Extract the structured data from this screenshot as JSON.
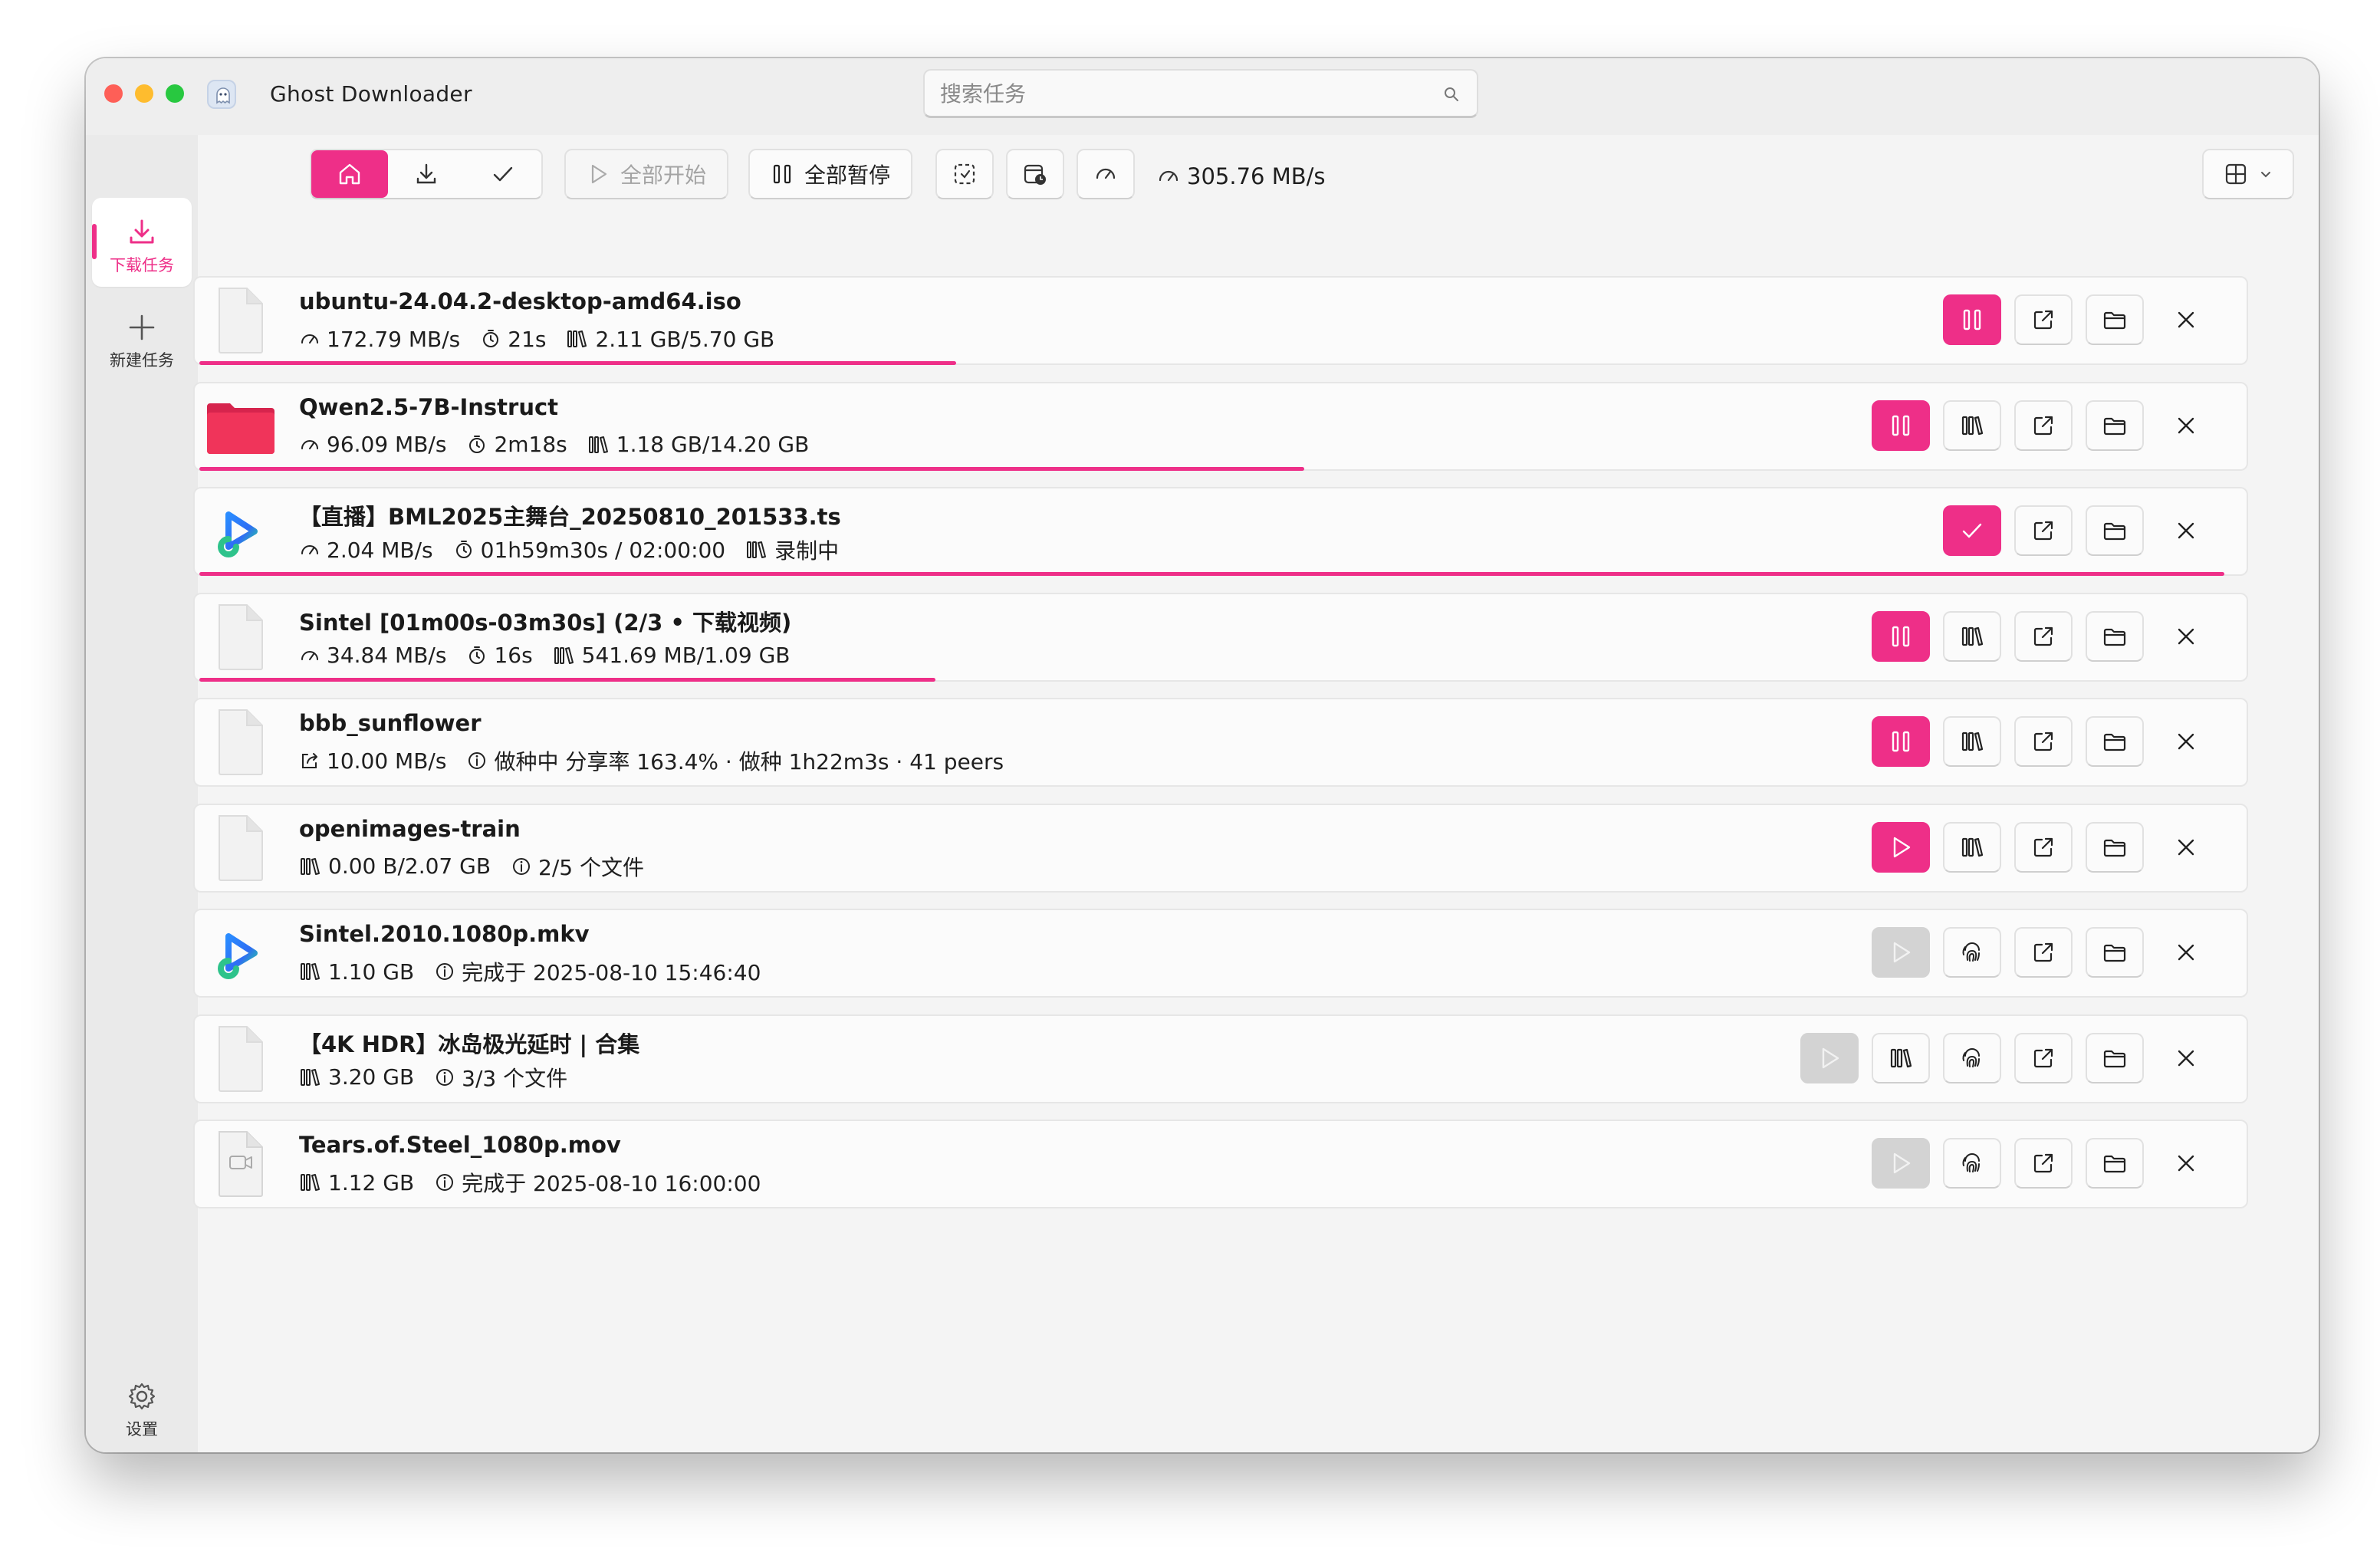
{
  "window": {
    "title": "Ghost Downloader"
  },
  "search": {
    "placeholder": "搜索任务",
    "value": ""
  },
  "sidebar": {
    "items": [
      {
        "label": "下载任务",
        "icon": "download-icon",
        "active": true
      },
      {
        "label": "新建任务",
        "icon": "plus-icon",
        "active": false
      }
    ],
    "settings_label": "设置"
  },
  "toolbar": {
    "filters": [
      "home-icon",
      "download-icon",
      "check-icon"
    ],
    "start_all_label": "全部开始",
    "pause_all_label": "全部暂停",
    "total_speed": "305.76 MB/s"
  },
  "colors": {
    "accent": "#ee2f88",
    "folder": "#f0345a",
    "disabled": "#d3d3d3"
  },
  "tasks": [
    {
      "name": "ubuntu-24.04.2-desktop-amd64.iso",
      "file_icon": "file-icon",
      "info": [
        {
          "icon": "speed-icon",
          "text": "172.79 MB/s"
        },
        {
          "icon": "timer-icon",
          "text": "21s"
        },
        {
          "icon": "library-icon",
          "text": "2.11 GB/5.70 GB"
        }
      ],
      "progress": 0.37,
      "actions": [
        "pause",
        "open-external",
        "folder",
        "close"
      ]
    },
    {
      "name": "Qwen2.5-7B-Instruct",
      "file_icon": "folder-icon",
      "info": [
        {
          "icon": "speed-icon",
          "text": "96.09 MB/s"
        },
        {
          "icon": "timer-icon",
          "text": "2m18s"
        },
        {
          "icon": "library-icon",
          "text": "1.18 GB/14.20 GB"
        }
      ],
      "progress": 0.54,
      "actions": [
        "pause",
        "library",
        "open-external",
        "folder",
        "close"
      ]
    },
    {
      "name": "【直播】BML2025主舞台_20250810_201533.ts",
      "file_icon": "bilibili-icon",
      "info": [
        {
          "icon": "speed-icon",
          "text": "2.04 MB/s"
        },
        {
          "icon": "timer-icon",
          "text": "01h59m30s / 02:00:00"
        },
        {
          "icon": "library-icon",
          "text": "录制中"
        }
      ],
      "progress": 0.99,
      "actions": [
        "check",
        "open-external",
        "folder",
        "close"
      ]
    },
    {
      "name": "Sintel [01m00s-03m30s] (2/3 • 下载视频)",
      "file_icon": "file-icon",
      "info": [
        {
          "icon": "speed-icon",
          "text": "34.84 MB/s"
        },
        {
          "icon": "timer-icon",
          "text": "16s"
        },
        {
          "icon": "library-icon",
          "text": "541.69 MB/1.09 GB"
        }
      ],
      "progress": 0.36,
      "actions": [
        "pause",
        "library",
        "open-external",
        "folder",
        "close"
      ]
    },
    {
      "name": "bbb_sunflower",
      "file_icon": "file-icon",
      "info": [
        {
          "icon": "share-icon",
          "text": "10.00 MB/s"
        },
        {
          "icon": "info-icon",
          "text": "做种中  分享率 163.4% · 做种 1h22m3s · 41 peers"
        }
      ],
      "progress": null,
      "actions": [
        "pause",
        "library",
        "open-external",
        "folder",
        "close"
      ]
    },
    {
      "name": "openimages-train",
      "file_icon": "file-icon",
      "info": [
        {
          "icon": "library-icon",
          "text": "0.00 B/2.07 GB"
        },
        {
          "icon": "info-icon",
          "text": "2/5 个文件"
        }
      ],
      "progress": null,
      "actions": [
        "play",
        "library",
        "open-external",
        "folder",
        "close"
      ]
    },
    {
      "name": "Sintel.2010.1080p.mkv",
      "file_icon": "bilibili-icon",
      "info": [
        {
          "icon": "library-icon",
          "text": "1.10 GB"
        },
        {
          "icon": "info-icon",
          "text": "完成于 2025-08-10 15:46:40"
        }
      ],
      "progress": null,
      "actions": [
        "play-disabled",
        "fingerprint",
        "open-external",
        "folder",
        "close"
      ]
    },
    {
      "name": "【4K HDR】冰岛极光延时 | 合集",
      "file_icon": "file-icon",
      "info": [
        {
          "icon": "library-icon",
          "text": "3.20 GB"
        },
        {
          "icon": "info-icon",
          "text": "3/3 个文件"
        }
      ],
      "progress": null,
      "actions": [
        "play-disabled",
        "library",
        "fingerprint",
        "open-external",
        "folder",
        "close"
      ]
    },
    {
      "name": "Tears.of.Steel_1080p.mov",
      "file_icon": "video-file-icon",
      "info": [
        {
          "icon": "library-icon",
          "text": "1.12 GB"
        },
        {
          "icon": "info-icon",
          "text": "完成于 2025-08-10 16:00:00"
        }
      ],
      "progress": null,
      "actions": [
        "play-disabled",
        "fingerprint",
        "open-external",
        "folder",
        "close"
      ]
    }
  ]
}
